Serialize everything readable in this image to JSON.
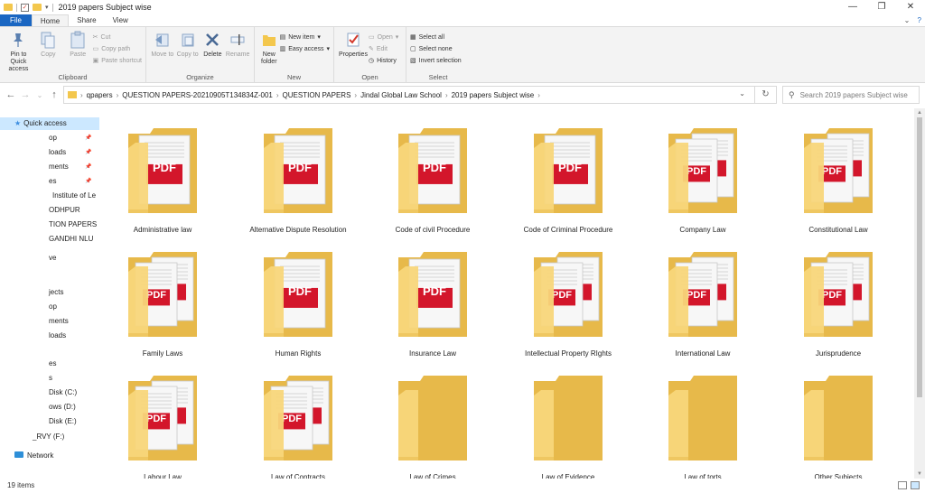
{
  "window": {
    "title": "2019 papers Subject wise",
    "controls": {
      "minimize": "—",
      "maximize": "❐",
      "close": "✕"
    }
  },
  "ribbon_tabs": [
    "File",
    "Home",
    "Share",
    "View"
  ],
  "ribbon": {
    "clipboard": {
      "label": "Clipboard",
      "pin": "Pin to Quick access",
      "copy": "Copy",
      "paste": "Paste",
      "cut": "Cut",
      "copy_path": "Copy path",
      "paste_shortcut": "Paste shortcut"
    },
    "organize": {
      "label": "Organize",
      "move_to": "Move to",
      "copy_to": "Copy to",
      "delete": "Delete",
      "rename": "Rename"
    },
    "new": {
      "label": "New",
      "new_folder": "New folder",
      "new_item": "New item",
      "easy_access": "Easy access"
    },
    "open": {
      "label": "Open",
      "properties": "Properties",
      "open": "Open",
      "edit": "Edit",
      "history": "History"
    },
    "select": {
      "label": "Select",
      "select_all": "Select all",
      "select_none": "Select none",
      "invert_selection": "Invert selection"
    }
  },
  "address": {
    "crumbs": [
      "qpapers",
      "QUESTION PAPERS-20210905T134834Z-001",
      "QUESTION PAPERS",
      "Jindal Global Law School",
      "2019 papers Subject wise"
    ]
  },
  "search": {
    "placeholder": "Search 2019 papers Subject wise"
  },
  "nav_pane": {
    "items": [
      {
        "label": "Quick access",
        "kind": "header"
      },
      {
        "label": "op",
        "pinned": true
      },
      {
        "label": "loads",
        "pinned": true
      },
      {
        "label": "ments",
        "pinned": true
      },
      {
        "label": "es",
        "pinned": true
      },
      {
        "label": "Institute of Le",
        "pinned": false
      },
      {
        "label": "ODHPUR",
        "pinned": false
      },
      {
        "label": "TION PAPERS",
        "pinned": false
      },
      {
        "label": "GANDHI NLU",
        "pinned": false
      },
      {
        "label": "ve",
        "pinned": false
      },
      {
        "label": "jects",
        "pinned": false
      },
      {
        "label": "op",
        "pinned": false
      },
      {
        "label": "ments",
        "pinned": false
      },
      {
        "label": "loads",
        "pinned": false
      },
      {
        "label": "es",
        "pinned": false
      },
      {
        "label": "s",
        "pinned": false
      },
      {
        "label": "Disk (C:)",
        "pinned": false
      },
      {
        "label": "ows (D:)",
        "pinned": false
      },
      {
        "label": "Disk (E:)",
        "pinned": false
      },
      {
        "label": "_RVY (F:)",
        "pinned": false
      },
      {
        "label": "Network",
        "kind": "network"
      }
    ]
  },
  "folders": [
    {
      "name": "Administrative law",
      "pdf": "single"
    },
    {
      "name": "Alternative Dispute Resolution",
      "pdf": "single"
    },
    {
      "name": "Code of civil Procedure",
      "pdf": "single"
    },
    {
      "name": "Code of Criminal Procedure",
      "pdf": "single"
    },
    {
      "name": "Company Law",
      "pdf": "multi"
    },
    {
      "name": "Constitutional Law",
      "pdf": "multi"
    },
    {
      "name": "Family Laws",
      "pdf": "multi"
    },
    {
      "name": "Human Rights",
      "pdf": "single"
    },
    {
      "name": "Insurance Law",
      "pdf": "single"
    },
    {
      "name": "Intellectual Property RIghts",
      "pdf": "multi"
    },
    {
      "name": "International Law",
      "pdf": "multi"
    },
    {
      "name": "Jurisprudence",
      "pdf": "multi"
    },
    {
      "name": "Labour Law",
      "pdf": "multi"
    },
    {
      "name": "Law of Contracts",
      "pdf": "multi"
    },
    {
      "name": "Law of Crimes",
      "pdf": "none"
    },
    {
      "name": "Law of Evidence",
      "pdf": "none"
    },
    {
      "name": "Law of torts",
      "pdf": "none"
    },
    {
      "name": "Other Subjects",
      "pdf": "none"
    }
  ],
  "pdf_badge": "PDF",
  "status": {
    "item_count": "19 items"
  },
  "colors": {
    "folder_back": "#e7b94a",
    "folder_front": "#f8d67a",
    "pdf_red": "#d3162b",
    "accent": "#1a66c2"
  }
}
